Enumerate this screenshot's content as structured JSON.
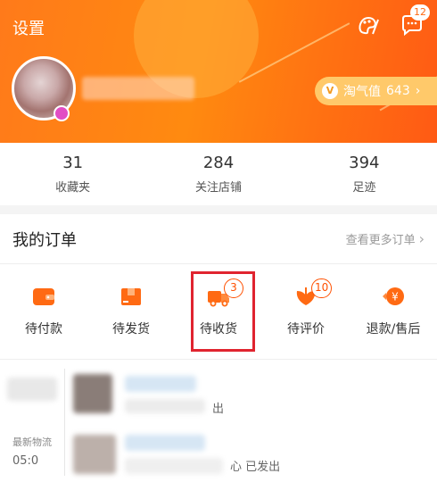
{
  "header": {
    "settings_label": "设置",
    "message_badge": "12",
    "taoqi_label": "淘气值",
    "taoqi_value": "643",
    "colors": {
      "primary": "#ff7a1a",
      "accent": "#ff5000",
      "gold": "#ffc96a"
    }
  },
  "stats": [
    {
      "value": "31",
      "label": "收藏夹"
    },
    {
      "value": "284",
      "label": "关注店铺"
    },
    {
      "value": "394",
      "label": "足迹"
    }
  ],
  "orders": {
    "title": "我的订单",
    "view_all": "查看更多订单",
    "items": [
      {
        "label": "待付款",
        "icon": "wallet-icon",
        "badge": ""
      },
      {
        "label": "待发货",
        "icon": "package-icon",
        "badge": ""
      },
      {
        "label": "待收货",
        "icon": "truck-icon",
        "badge": "3"
      },
      {
        "label": "待评价",
        "icon": "review-icon",
        "badge": "10"
      },
      {
        "label": "退款/售后",
        "icon": "refund-icon",
        "badge": ""
      }
    ]
  },
  "logistics": [
    {
      "label": "",
      "time": "",
      "status": "出"
    },
    {
      "label": "最新物流",
      "time": "05:0",
      "status": "心 已发出"
    }
  ]
}
